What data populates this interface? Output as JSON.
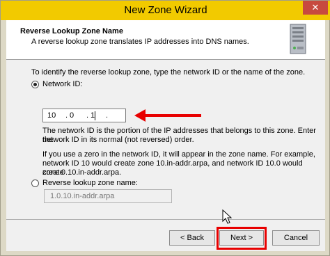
{
  "window": {
    "title": "New Zone Wizard",
    "close_glyph": "✕"
  },
  "header": {
    "title": "Reverse Lookup Zone Name",
    "subtitle": "A reverse lookup zone translates IP addresses into DNS names.",
    "icon": "server-icon"
  },
  "body": {
    "instruction": "To identify the reverse lookup zone, type the network ID or the name of the zone.",
    "network_id_option": {
      "label": "Network ID:",
      "selected": true
    },
    "network_id_octets": [
      "10",
      "0",
      "1",
      ""
    ],
    "octet_separator": ".",
    "description_1_line1": "The network ID is the portion of the IP addresses that belongs to this zone. Enter the",
    "description_1_line2": "network ID in its normal (not reversed) order.",
    "description_2_line1": "If you use a zero in the network ID, it will appear in the zone name. For example,",
    "description_2_line2": "network ID 10 would create zone 10.in-addr.arpa, and network ID 10.0 would create",
    "description_2_line3": "zone 0.10.in-addr.arpa.",
    "zone_name_option": {
      "label": "Reverse lookup zone name:",
      "selected": false
    },
    "zone_name_value": "1.0.10.in-addr.arpa"
  },
  "buttons": {
    "back": "< Back",
    "next": "Next >",
    "cancel": "Cancel"
  },
  "annotations": {
    "highlight_color": "#e80000"
  }
}
